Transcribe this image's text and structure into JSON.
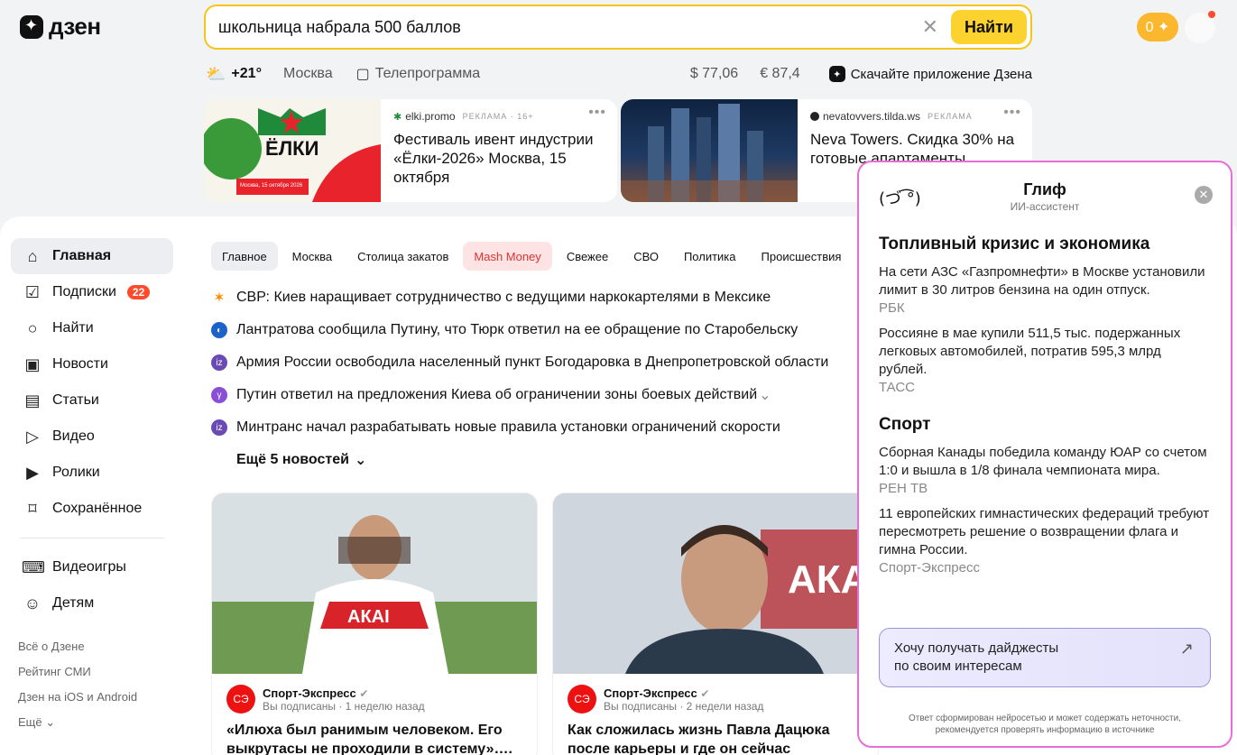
{
  "header": {
    "logo_text": "дзен",
    "search_value": "школьница набрала 500 баллов",
    "search_button": "Найти",
    "clear_glyph": "✕",
    "coins": "0 ✦"
  },
  "info": {
    "temperature": "+21°",
    "city": "Москва",
    "tv": "Телепрограмма",
    "usd": "$ 77,06",
    "eur": "€ 87,4",
    "app": "Скачайте приложение Дзена"
  },
  "ads": [
    {
      "source": "elki.promo",
      "tag": "РЕКЛАМА · 16+",
      "title": "Фестиваль ивент индустрии «Ёлки-2026» Москва, 15 октября",
      "img_text": "ЁЛКИ",
      "img_sub": "Москва, 15 октября 2026"
    },
    {
      "source": "nevatovvers.tilda.ws",
      "tag": "РЕКЛАМА",
      "title": "Neva Towers. Скидка 30% на готовые апартаменты"
    }
  ],
  "sidebar": {
    "items": [
      {
        "label": "Главная",
        "icon": "⌂"
      },
      {
        "label": "Подписки",
        "icon": "☑",
        "badge": "22"
      },
      {
        "label": "Найти",
        "icon": "○"
      },
      {
        "label": "Новости",
        "icon": "▣"
      },
      {
        "label": "Статьи",
        "icon": "▤"
      },
      {
        "label": "Видео",
        "icon": "▷"
      },
      {
        "label": "Ролики",
        "icon": "▶"
      },
      {
        "label": "Сохранённое",
        "icon": "⌑"
      }
    ],
    "extra": [
      {
        "label": "Видеоигры",
        "icon": "⌨"
      },
      {
        "label": "Детям",
        "icon": "☺"
      }
    ],
    "footer": [
      "Всё о Дзене",
      "Рейтинг СМИ",
      "Дзен на iOS и Android",
      "Ещё ⌄"
    ]
  },
  "tabs": [
    "Главное",
    "Москва",
    "Столица закатов",
    "Mash Money",
    "Свежее",
    "СВО",
    "Политика",
    "Происшествия"
  ],
  "news": [
    {
      "text": "СВР: Киев наращивает сотрудничество с ведущими наркокартелями в Мексике",
      "color": "#ff8a00",
      "glyph": "✶"
    },
    {
      "text": "Лантратова сообщила Путину, что Тюрк ответил на ее обращение по Старобельску",
      "color": "#1c63c9",
      "glyph": "◐"
    },
    {
      "text": "Армия России освободила населенный пункт Богодаровка в Днепропетровской области",
      "color": "#6a4bb5",
      "glyph": "iz"
    },
    {
      "text": "Путин ответил на предложения Киева об ограничении зоны боевых действий",
      "color": "#8a4fd6",
      "glyph": "γ"
    },
    {
      "text": "Минтранс начал разрабатывать новые правила установки ограничений скорости",
      "color": "#6a4bb5",
      "glyph": "iz"
    }
  ],
  "news_more": "Ещё 5 новостей",
  "cards": [
    {
      "source": "Спорт-Экспресс",
      "meta": "Вы подписаны · 1 неделю назад",
      "title": "«Илюха был ранимым человеком. Его выкрутасы не проходили в систему»….",
      "shirt_text": "АКАІ"
    },
    {
      "source": "Спорт-Экспресс",
      "meta": "Вы подписаны · 2 недели назад",
      "title": "Как сложилась жизнь Павла Дацюка после карьеры и где он сейчас",
      "bg_text": "АКА"
    }
  ],
  "panel": {
    "face": "(づ ͡°)",
    "title": "Глиф",
    "subtitle": "ИИ-ассистент",
    "sections": [
      {
        "title": "Топливный кризис и экономика",
        "items": [
          {
            "text": "На сети АЗС «Газпромнефти» в Москве установили лимит в 30 литров бензина на один отпуск.",
            "source": "РБК"
          },
          {
            "text": "Россияне в мае купили 511,5 тыс. подержанных легковых автомобилей, потратив 595,3 млрд рублей.",
            "source": "ТАСС"
          }
        ]
      },
      {
        "title": "Спорт",
        "items": [
          {
            "text": "Сборная Канады победила команду ЮАР со счетом 1:0 и вышла в 1/8 финала чемпионата мира.",
            "source": "РЕН ТВ"
          },
          {
            "text": "11 европейских гимнастических федераций требуют пересмотреть решение о возвращении флага и гимна России.",
            "source": "Спорт-Экспресс"
          }
        ]
      }
    ],
    "digest_line1": "Хочу получать дайджесты",
    "digest_line2": "по своим интересам",
    "digest_arrow": "↗",
    "footer_line1": "Ответ сформирован нейросетью и может содержать неточности,",
    "footer_line2": "рекомендуется проверять информацию в источнике"
  }
}
